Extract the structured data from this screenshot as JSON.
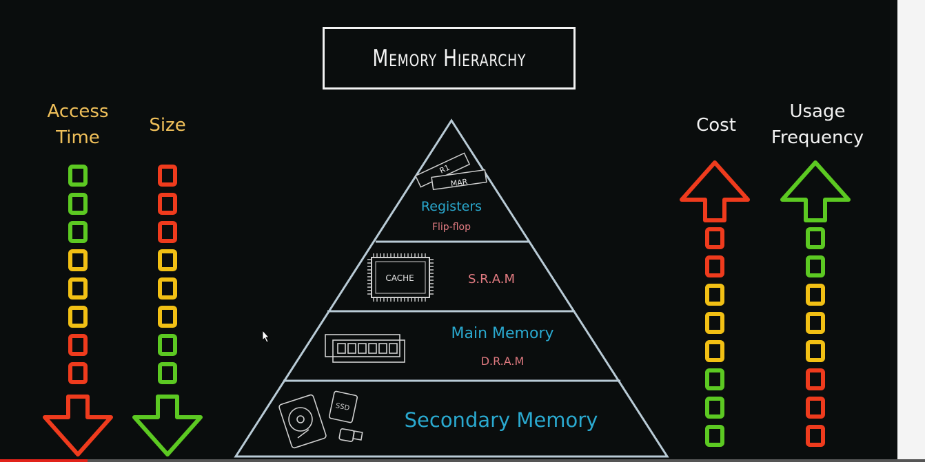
{
  "title": "Memory Hierarchy",
  "left_indicators": [
    {
      "label": "Access\nTime",
      "colors": [
        "#5cc922",
        "#5cc922",
        "#5cc922",
        "#f2c014",
        "#f2c014",
        "#f2c014",
        "#ef3b1d",
        "#ef3b1d"
      ],
      "arrow_color": "#ef3b1d",
      "direction": "down"
    },
    {
      "label": "Size",
      "colors": [
        "#ef3b1d",
        "#ef3b1d",
        "#ef3b1d",
        "#f2c014",
        "#f2c014",
        "#f2c014",
        "#5cc922",
        "#5cc922"
      ],
      "arrow_color": "#5cc922",
      "direction": "down"
    }
  ],
  "right_indicators": [
    {
      "label": "Cost",
      "colors": [
        "#ef3b1d",
        "#ef3b1d",
        "#f2c014",
        "#f2c014",
        "#f2c014",
        "#5cc922",
        "#5cc922",
        "#5cc922"
      ],
      "arrow_color": "#ef3b1d",
      "direction": "up"
    },
    {
      "label": "Usage\nFrequency",
      "colors": [
        "#5cc922",
        "#5cc922",
        "#f2c014",
        "#f2c014",
        "#f2c014",
        "#ef3b1d",
        "#ef3b1d",
        "#ef3b1d"
      ],
      "arrow_color": "#5cc922",
      "direction": "up"
    }
  ],
  "pyramid": {
    "levels": [
      {
        "name": "Registers",
        "sub": "Flip-flop",
        "chips": [
          "R1",
          "MAR"
        ]
      },
      {
        "name": "",
        "sub": "S.R.A.M",
        "chip": "CACHE"
      },
      {
        "name": "Main Memory",
        "sub": "D.R.A.M"
      },
      {
        "name": "Secondary Memory",
        "sub": "",
        "chip": "SSD"
      }
    ]
  },
  "colors": {
    "background": "#0a0d0d",
    "level_name": "#2aa9cf",
    "level_sub": "#e07a80",
    "label": "#f0c05a",
    "white": "#f2f2f2",
    "red": "#ef3b1d",
    "yellow": "#f2c014",
    "green": "#5cc922",
    "pyramid_line": "#b9cbd6"
  },
  "video_progress": 0.095
}
